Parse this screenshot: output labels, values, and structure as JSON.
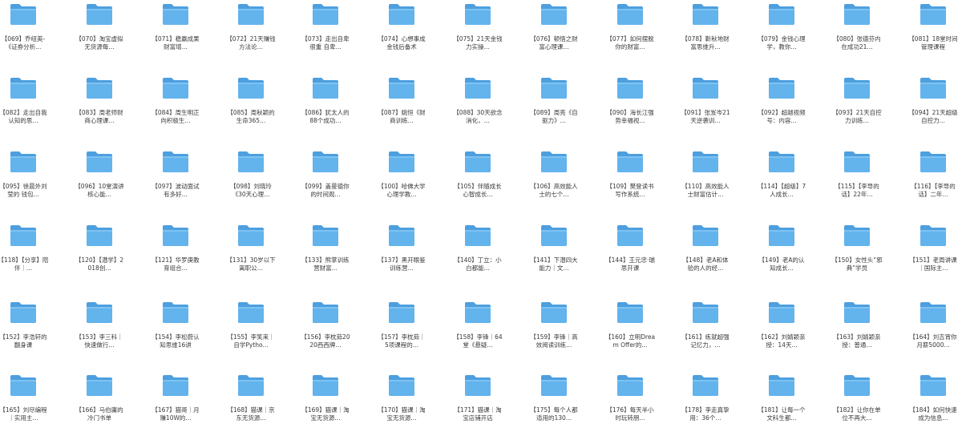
{
  "folder_icon": {
    "name": "folder-icon",
    "front_color": "#63b3ec",
    "back_color": "#4d9fdf",
    "tab_color": "#7ec3f2"
  },
  "rows": [
    [
      "【069】乔纽英-《证券分析...",
      "【070】淘宝虚拟无货源每...",
      "【071】稳赢成果财富增...",
      "【072】21天赚钱方法论...",
      "【073】走出自卑很重 自卑...",
      "【074】心想事成金钱后备术",
      "【075】21天金钱力实操...",
      "【076】顿悟之财富心理课...",
      "【077】如何摆脱你的财富...",
      "【078】靳秋地财富思维升...",
      "【079】金钱心理学，教你...",
      "【080】张德芬内在成功21...",
      "【081】18堂时间管理课程"
    ],
    [
      "【082】走出自我认知的思...",
      "【083】周老师财商心理课...",
      "【084】周生明正向积极生...",
      "【085】周秋颖的生命365...",
      "【086】犹太人的88个成功...",
      "【087】姚恒《财商训练...",
      "【088】30天欲念消化，...",
      "【089】周亮《自驱力》...",
      "【090】海长江强势幸福视...",
      "【091】张岌岑21天逆袭训...",
      "【092】超越视频号：内容...",
      "【093】21天自控力训练...",
      "【094】21天超级自控力..."
    ],
    [
      "【095】徐晨外刘莹的 钱包...",
      "【096】10堂演讲核心能...",
      "【097】波动面试有多好...",
      "【098】刘晓玲《30天心理...",
      "【099】盖曼德你的时间观...",
      "【100】哈佛大学心理学教...",
      "【105】伴随成长心智成长...",
      "【106】高效能人士的七个...",
      "【109】樊登读书写作系统...",
      "【110】高效能人士财富估计...",
      "【114】【超级】7人成长...",
      "【115】【李导的话】22年...",
      "【116】【李导的话】二年..."
    ],
    [
      "【118】【分享】陪伴｜...",
      "【120】【潜学】2018创...",
      "【121】华罗庚教育组合...",
      "【131】30岁以下离职公...",
      "【133】熊掌训练营财富...",
      "【137】黑开眼鉴训练营...",
      "【140】丁立：小白都能...",
      "【141】下潜四大能力｜文...",
      "【144】王元忠·瑞思开课",
      "【148】老A和体验的人的经...",
      "【149】老A的认知成长...",
      "【150】女性头“邪典”学员",
      "【151】老周讲课｜国际主..."
    ],
    [
      "【152】李浩轩的翻身课",
      "【153】李三科｜快速做行...",
      "【154】李松蔚认知思维16讲",
      "【155】李笑来｜自学Pytho...",
      "【156】李枕茹2020西西牌...",
      "【157】李枕茹｜5项课程的...",
      "【158】李锋｜64堂《悬疑...",
      "【159】李锋｜高效阅读训练...",
      "【160】立明Dream Offer的...",
      "【161】练就超强记忆力，...",
      "【162】刘婧颖亲授：14天...",
      "【163】刘婧颖亲授：普通...",
      "【164】刘吉宵你月薪5000..."
    ],
    [
      "【165】刘尽编程｜实用主...",
      "【166】马伯庸的冷门书单",
      "【167】猫哥｜月赚10W的...",
      "【168】猫课｜京东无货源...",
      "【169】猫课｜淘宝无货源...",
      "【170】猫课｜淘宝无货源...",
      "【171】猫课｜淘宝店铺开店",
      "【175】每个人都适用的130...",
      "【176】每天半小时玩转朋...",
      "【178】李走真挚用：36个...",
      "【181】让每一个文科生都...",
      "【182】让你在单位不再大...",
      "【184】如何快速成为信息..."
    ]
  ]
}
